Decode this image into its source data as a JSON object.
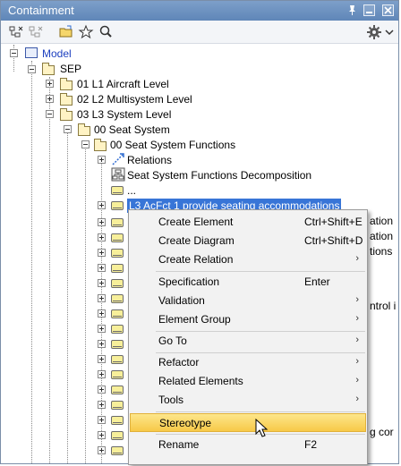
{
  "panel": {
    "title": "Containment"
  },
  "toolbar": {
    "icons": [
      "collapse-all-icon",
      "expand-all-icon",
      "open-folder-icon",
      "star-icon",
      "search-icon",
      "gear-icon",
      "chevron-down-icon"
    ]
  },
  "tree": {
    "model": "Model",
    "sep": "SEP",
    "l1": "01 L1 Aircraft Level",
    "l2": "02 L2 Multisystem Level",
    "l3": "03 L3 System Level",
    "seat_system": "00 Seat System",
    "seat_functions": "00 Seat System Functions",
    "relations": "Relations",
    "decomposition": "Seat System Functions Decomposition",
    "ellipsis": "...",
    "selected": "L3 AcFct 1 provide seating accommodations",
    "peek": [
      "ation",
      "ation",
      "tions",
      "ntrol i",
      "g cor"
    ]
  },
  "menu": {
    "items": [
      {
        "label": "Create Element",
        "shortcut": "Ctrl+Shift+E"
      },
      {
        "label": "Create Diagram",
        "shortcut": "Ctrl+Shift+D"
      },
      {
        "label": "Create Relation",
        "shortcut": ""
      },
      {
        "label": "Specification",
        "shortcut": "Enter"
      },
      {
        "label": "Validation",
        "shortcut": ""
      },
      {
        "label": "Element Group",
        "shortcut": ""
      },
      {
        "label": "Go To",
        "shortcut": ""
      },
      {
        "label": "Refactor",
        "shortcut": ""
      },
      {
        "label": "Related Elements",
        "shortcut": ""
      },
      {
        "label": "Tools",
        "shortcut": ""
      },
      {
        "label": "Stereotype",
        "shortcut": ""
      },
      {
        "label": "Rename",
        "shortcut": "F2"
      }
    ],
    "submenu_arrow": "›"
  },
  "colors": {
    "titlebar": "#6f92c2",
    "selection": "#3875d7",
    "highlight": "#f7c948"
  }
}
